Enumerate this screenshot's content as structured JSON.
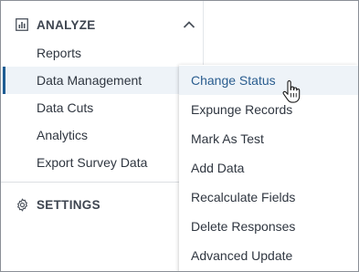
{
  "sidebar": {
    "analyze": {
      "label": "ANALYZE",
      "icon": "bar-chart-icon",
      "toggle_icon": "chevron-up-icon"
    },
    "items": [
      {
        "label": "Reports"
      },
      {
        "label": "Data Management",
        "active": true
      },
      {
        "label": "Data Cuts"
      },
      {
        "label": "Analytics"
      },
      {
        "label": "Export Survey Data"
      }
    ],
    "settings": {
      "label": "SETTINGS",
      "icon": "gear-icon"
    }
  },
  "submenu": {
    "items": [
      {
        "label": "Change Status",
        "hovered": true
      },
      {
        "label": "Expunge Records"
      },
      {
        "label": "Mark As Test"
      },
      {
        "label": "Add Data"
      },
      {
        "label": "Recalculate Fields"
      },
      {
        "label": "Delete Responses"
      },
      {
        "label": "Advanced Update"
      }
    ]
  },
  "colors": {
    "accent": "#1f5d93",
    "hover_bg": "#eef3f8",
    "text": "#2f3640"
  }
}
